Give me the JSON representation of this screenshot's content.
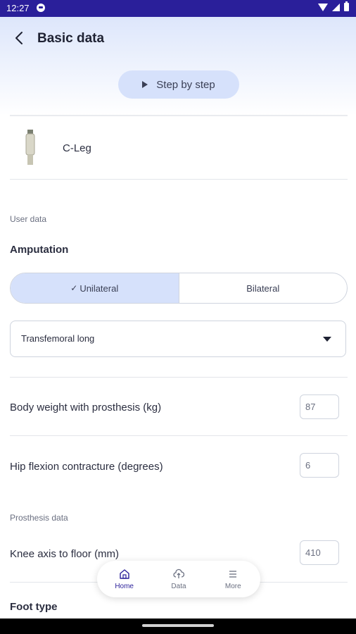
{
  "status": {
    "time": "12:27"
  },
  "header": {
    "title": "Basic data"
  },
  "step_button": {
    "label": "Step by step"
  },
  "product": {
    "name": "C-Leg"
  },
  "user_data": {
    "section_label": "User data",
    "amputation_title": "Amputation",
    "segments": [
      {
        "label": "Unilateral",
        "selected": true
      },
      {
        "label": "Bilateral",
        "selected": false
      }
    ],
    "amputation_level": "Transfemoral long",
    "body_weight": {
      "label": "Body weight with prosthesis (kg)",
      "value": "87"
    },
    "hip_flexion": {
      "label": "Hip flexion contracture (degrees)",
      "value": "6"
    }
  },
  "prosthesis_data": {
    "section_label": "Prosthesis data",
    "knee_axis": {
      "label": "Knee axis to floor (mm)",
      "value": "410"
    },
    "foot_type_title": "Foot type"
  },
  "bottom_nav": {
    "items": [
      {
        "label": "Home",
        "icon": "home-icon",
        "active": true
      },
      {
        "label": "Data",
        "icon": "cloud-upload-icon",
        "active": false
      },
      {
        "label": "More",
        "icon": "list-icon",
        "active": false
      }
    ]
  },
  "colors": {
    "accent": "#2a1f9a",
    "selected_bg": "#d6e1fb"
  }
}
